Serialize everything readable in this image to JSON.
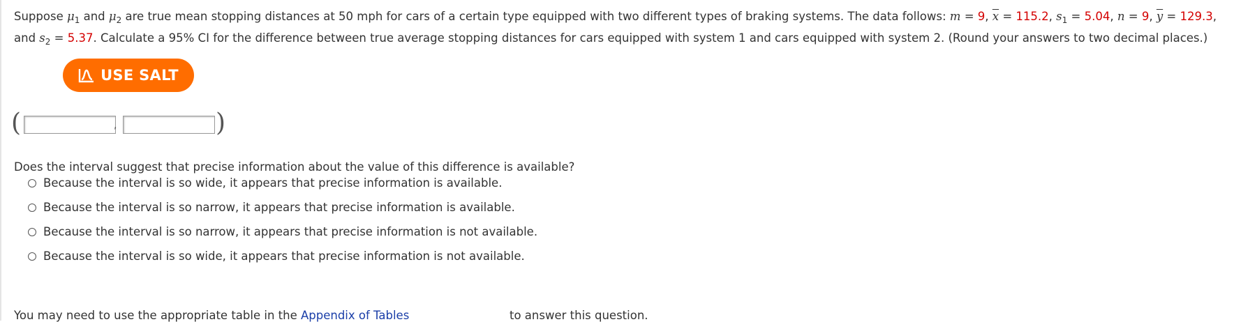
{
  "question": {
    "t_suppose": "Suppose ",
    "t_mu": "μ",
    "t_sub1": "1",
    "t_and": " and ",
    "t_sub2": "2",
    "t_after_mu2": " are true mean stopping distances at 50 mph for cars of a certain type equipped with two different types of braking systems. The data follows: ",
    "t_m": "m",
    "t_eq": " = ",
    "m_value": "9",
    "t_comma": ", ",
    "t_x": "x",
    "x_value": "115.2",
    "t_s": "s",
    "s1_value": "5.04",
    "t_n": "n",
    "n_value": "9",
    "t_y": "y",
    "y_value": "129.3",
    "t_and2": "and ",
    "s2_value": "5.37",
    "t_rest": ". Calculate a 95% CI for the difference between true average stopping distances for cars equipped with system 1 and cars equipped with system 2. (Round your answers to two decimal places.)"
  },
  "salt_button": {
    "label": "USE SALT",
    "icon": "salt-chart-icon",
    "color": "#ff6d00"
  },
  "ci": {
    "open": "(",
    "close": ")",
    "separator": ",",
    "lower_value": "",
    "upper_value": ""
  },
  "prompt": "Does the interval suggest that precise information about the value of this difference is available?",
  "options": [
    "Because the interval is so wide, it appears that precise information is available.",
    "Because the interval is so narrow, it appears that precise information is available.",
    "Because the interval is so narrow, it appears that precise information is not available.",
    "Because the interval is so wide, it appears that precise information is not available."
  ],
  "footer": {
    "before": "You may need to use the appropriate table in the ",
    "link": "Appendix of Tables",
    "after": "to answer this question."
  },
  "colors": {
    "value_red": "#d40000",
    "link_blue": "#1a3ea8"
  }
}
